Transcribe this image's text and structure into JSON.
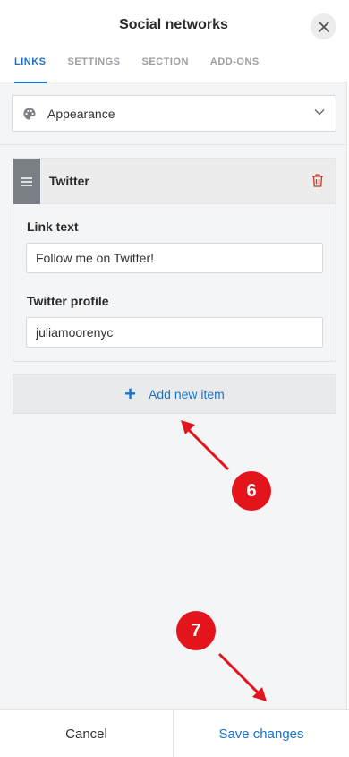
{
  "header": {
    "title": "Social networks",
    "tabs": [
      {
        "label": "LINKS",
        "active": true
      },
      {
        "label": "SETTINGS",
        "active": false
      },
      {
        "label": "SECTION",
        "active": false
      },
      {
        "label": "ADD-ONS",
        "active": false
      }
    ]
  },
  "appearance": {
    "label": "Appearance"
  },
  "item": {
    "title": "Twitter",
    "link_text_label": "Link text",
    "link_text_value": "Follow me on Twitter!",
    "profile_label": "Twitter profile",
    "profile_value": "juliamoorenyc"
  },
  "add_item": {
    "label": "Add new item"
  },
  "footer": {
    "cancel_label": "Cancel",
    "save_label": "Save changes"
  },
  "annotations": {
    "badge_6": "6",
    "badge_7": "7"
  },
  "colors": {
    "accent": "#1a73c8",
    "annotation": "#e3141b",
    "delete": "#c0392b"
  }
}
